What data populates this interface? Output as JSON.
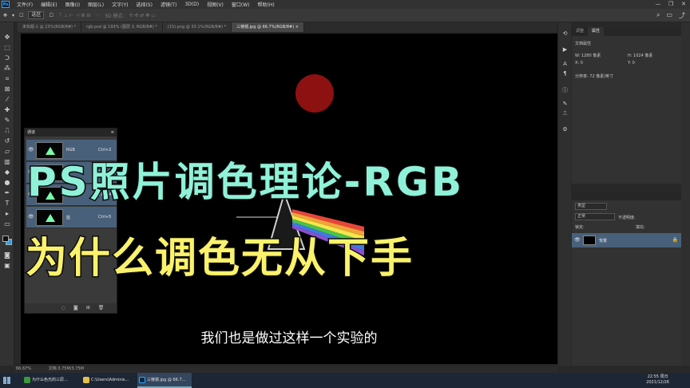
{
  "menu": {
    "logo": "Ps",
    "items": [
      "文件(F)",
      "编辑(E)",
      "图像(I)",
      "图层(L)",
      "文字(Y)",
      "选择(S)",
      "滤镜(T)",
      "3D(D)",
      "视图(V)",
      "窗口(W)",
      "帮助(H)"
    ],
    "win": [
      "—",
      "❐",
      "✕"
    ]
  },
  "options": {
    "mode": "选区",
    "mode3d": "3D 模式:",
    "more": "···"
  },
  "tabs": [
    "未标题-1 @ 23%(RGB/8#) *",
    "rgb.psd @ 193% (图层 3, RGB/8#) *",
    "(15).png @ 33.1%(RGB/8#) *",
    "三棱镜.jpg @ 66.7%(RGB/8#) ×"
  ],
  "canvas": {
    "subtitle": "我们也是做过这样一个实验的"
  },
  "overlay": {
    "title1": "PS照片调色理论-RGB",
    "title2": "为什么调色无从下手"
  },
  "channels": {
    "title": "通道",
    "rows": [
      {
        "name": "RGB",
        "shortcut": "Ctrl+2"
      },
      {
        "name": "红",
        "shortcut": "Ctrl+3"
      },
      {
        "name": "绿",
        "shortcut": "Ctrl+4"
      },
      {
        "name": "蓝",
        "shortcut": "Ctrl+5"
      }
    ]
  },
  "properties": {
    "tabs": [
      "调整",
      "属性"
    ],
    "doc_label": "文档属性",
    "w": "W:  1280 像素",
    "h": "H:  1024 像素",
    "x": "X:  0",
    "y": "Y:  0",
    "resolution": "分辨率: 72 像素/英寸"
  },
  "layers": {
    "kind": "类型",
    "blend": "正常",
    "opacity": "不透明度:",
    "lock": "锁定:",
    "fill": "填充:",
    "layer_name": "背景"
  },
  "status": {
    "zoom": "66.67%",
    "doc": "文档:3.75M/3.75M"
  },
  "taskbar": {
    "items": [
      "为什么色光的三原...",
      "C:\\Users\\Adminis...",
      "三棱镜.jpg @ 66.7..."
    ],
    "time": "22:55 周日",
    "date": "2021/12/26"
  },
  "colors": {
    "accent_cyan": "#8ff2d8",
    "accent_yellow": "#fbf26c",
    "selection_blue": "#48607a",
    "red_dot": "#8d1111"
  }
}
